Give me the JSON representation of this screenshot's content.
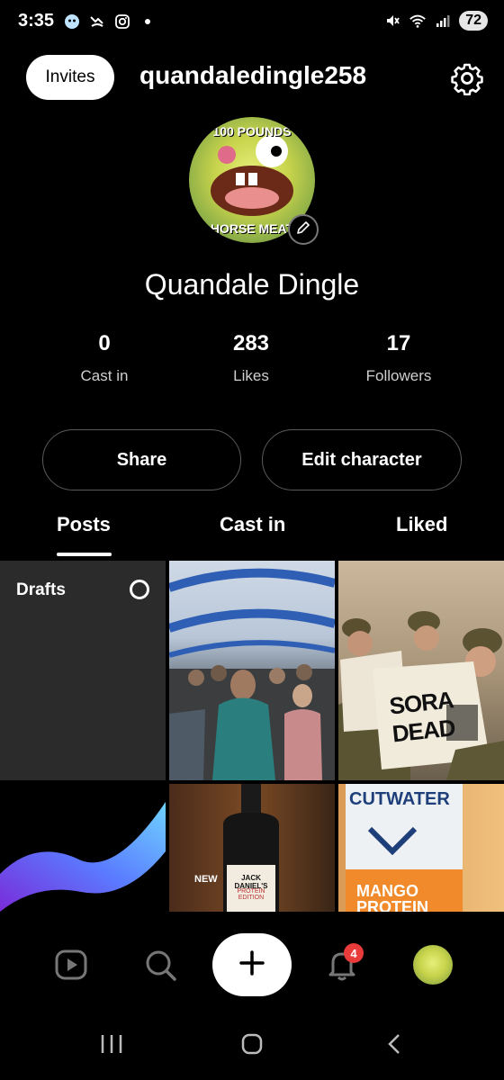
{
  "status_bar": {
    "time": "3:35",
    "battery": "72",
    "icons": [
      "ai-face-icon",
      "missed-call-icon",
      "instagram-icon",
      "dot-icon",
      "mute-icon",
      "wifi-icon",
      "signal-icon"
    ]
  },
  "header": {
    "invites_label": "Invites",
    "username": "quandaledingle258",
    "settings_icon": "gear-icon"
  },
  "profile": {
    "avatar_top_text": "100 POUNDS",
    "avatar_bottom_text": "HORSE MEAT",
    "display_name": "Quandale Dingle",
    "stats": [
      {
        "value": "0",
        "label": "Cast in"
      },
      {
        "value": "283",
        "label": "Likes"
      },
      {
        "value": "17",
        "label": "Followers"
      }
    ]
  },
  "actions": {
    "share_label": "Share",
    "edit_label": "Edit character"
  },
  "tabs": [
    {
      "label": "Posts",
      "active": true
    },
    {
      "label": "Cast in",
      "active": false
    },
    {
      "label": "Liked",
      "active": false
    }
  ],
  "grid": {
    "drafts_label": "Drafts",
    "newspaper_text": "SORA DEAD",
    "jd_badge": "NEW",
    "jd_label": "JACK DANIEL'S",
    "jd_sub": "PROTEIN EDITION",
    "can_brand": "CUTWATER",
    "can_flavor": "MANGO PROTEIN"
  },
  "bottom_nav": {
    "items": [
      "play-icon",
      "search-icon",
      "plus-icon",
      "bell-icon",
      "profile-avatar"
    ],
    "notification_count": "4"
  },
  "colors": {
    "background": "#000000",
    "accent_badge": "#ea3b3b",
    "drafts_tile": "#2b2b2b"
  }
}
